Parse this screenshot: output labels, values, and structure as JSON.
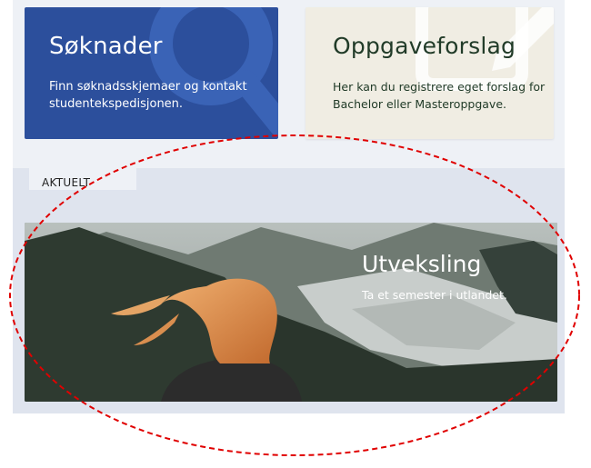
{
  "cards": [
    {
      "title": "Søknader",
      "description": "Finn søknadsskjemaer og kontakt studentekspedisjonen.",
      "color": "#2c4f9c",
      "icon": "magnifier-icon"
    },
    {
      "title": "Oppgaveforslag",
      "description": "Her kan du registrere eget forslag for Bachelor eller Masteroppgave.",
      "color": "#f0ede3",
      "icon": "document-edit-icon"
    }
  ],
  "tab": {
    "label": "AKTUELT"
  },
  "banner": {
    "title": "Utveksling",
    "subtitle": "Ta et semester i utlandet.",
    "image": "mountain-landscape-with-woman"
  },
  "annotation": {
    "shape": "dashed-ellipse",
    "color": "#e00000"
  }
}
